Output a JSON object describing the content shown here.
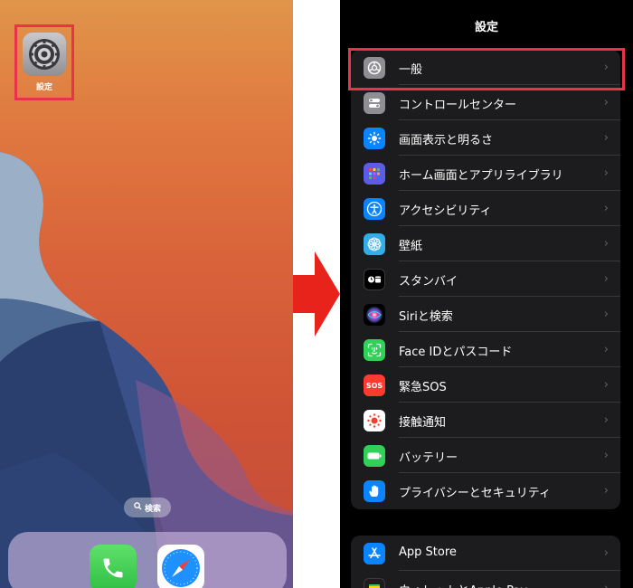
{
  "home_screen": {
    "app_label": "設定",
    "search_label": "検索",
    "dock_apps": [
      {
        "icon": "phone-icon",
        "color": "#34c759"
      },
      {
        "icon": "safari-icon",
        "color": "#1e90ff"
      }
    ],
    "highlight_color": "#e8344a"
  },
  "arrow_color": "#e8231c",
  "settings_screen": {
    "title": "設定",
    "rows": [
      {
        "label": "一般",
        "icon": "gear-icon",
        "color": "#8e8e93"
      },
      {
        "label": "コントロールセンター",
        "icon": "toggle-icon",
        "color": "#8e8e93"
      },
      {
        "label": "画面表示と明るさ",
        "icon": "sun-icon",
        "color": "#0a84ff"
      },
      {
        "label": "ホーム画面とアプリライブラリ",
        "icon": "app-grid-icon",
        "color": "#5e5ce6"
      },
      {
        "label": "アクセシビリティ",
        "icon": "accessibility-icon",
        "color": "#0a84ff"
      },
      {
        "label": "壁紙",
        "icon": "flower-icon",
        "color": "#32ade6"
      },
      {
        "label": "スタンバイ",
        "icon": "standby-icon",
        "color": "#1c1c1e"
      },
      {
        "label": "Siriと検索",
        "icon": "siri-icon",
        "color": "#000000"
      },
      {
        "label": "Face IDとパスコード",
        "icon": "face-id-icon",
        "color": "#30d158"
      },
      {
        "label": "緊急SOS",
        "icon": "sos-icon",
        "color": "#ff3b30"
      },
      {
        "label": "接触通知",
        "icon": "exposure-icon",
        "color": "#ffffff"
      },
      {
        "label": "バッテリー",
        "icon": "battery-icon",
        "color": "#30d158"
      },
      {
        "label": "プライバシーとセキュリティ",
        "icon": "hand-icon",
        "color": "#0a84ff"
      }
    ],
    "rows_2": [
      {
        "label": "App Store",
        "icon": "app-store-icon",
        "color": "#0a84ff"
      },
      {
        "label": "ウォレットとApple Pay",
        "icon": "wallet-icon",
        "color": "#1c1c1e"
      }
    ],
    "sos_text": "SOS",
    "highlight_color": "#e8344a"
  }
}
